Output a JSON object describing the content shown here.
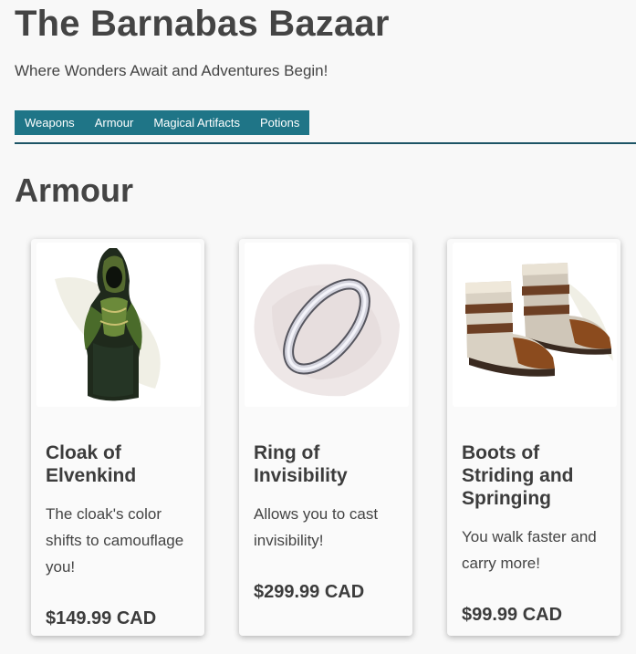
{
  "site": {
    "title": "The Barnabas Bazaar",
    "tagline": "Where Wonders Await and Adventures Begin!"
  },
  "nav": {
    "items": [
      "Weapons",
      "Armour",
      "Magical Artifacts",
      "Potions"
    ]
  },
  "section": {
    "title": "Armour"
  },
  "products": [
    {
      "name": "Cloak of Elvenkind",
      "description": "The cloak's color shifts to camouflage you!",
      "price": "$149.99 CAD",
      "image_icon": "cloak-icon"
    },
    {
      "name": "Ring of Invisibility",
      "description": "Allows you to cast invisibility!",
      "price": "$299.99 CAD",
      "image_icon": "ring-icon"
    },
    {
      "name": "Boots of Striding and Springing",
      "description": "You walk faster and carry more!",
      "price": "$99.99 CAD",
      "image_icon": "boots-icon"
    }
  ],
  "colors": {
    "nav_background": "#1f7587",
    "nav_rule": "#1d5566",
    "page_background": "#f8f8f8",
    "text": "#444444"
  }
}
